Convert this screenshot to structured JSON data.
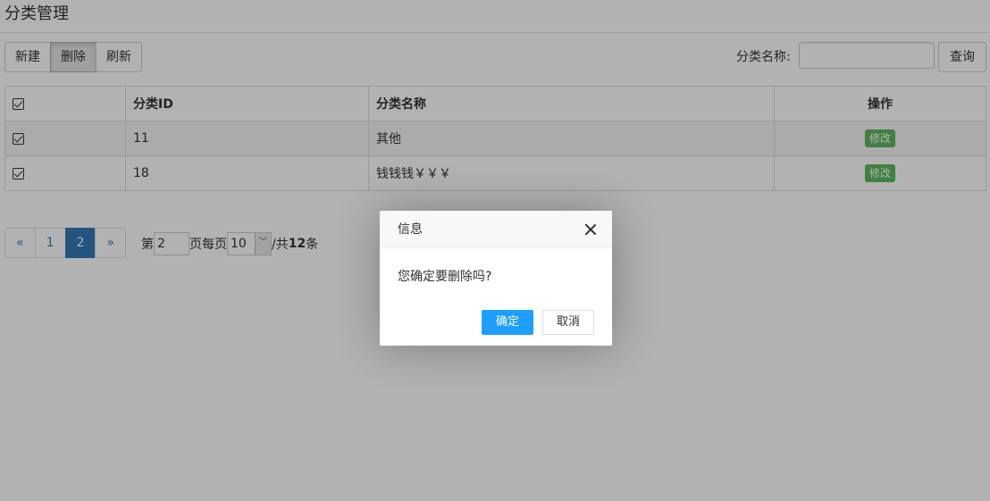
{
  "page": {
    "title": "分类管理"
  },
  "toolbar": {
    "new_label": "新建",
    "delete_label": "删除",
    "refresh_label": "刷新",
    "search_label": "分类名称:",
    "search_value": "",
    "search_button_label": "查询"
  },
  "table": {
    "headers": {
      "check": "",
      "id": "分类ID",
      "name": "分类名称",
      "operation": "操作"
    },
    "rows": [
      {
        "checked": true,
        "id": "11",
        "name": "其他",
        "action_label": "修改"
      },
      {
        "checked": true,
        "id": "18",
        "name": "钱钱钱￥￥￥",
        "action_label": "修改"
      }
    ]
  },
  "pagination": {
    "prev_label": "«",
    "pages": [
      "1",
      "2"
    ],
    "current_page": "2",
    "next_label": "»",
    "goto_prefix": "第",
    "goto_value": "2",
    "goto_suffix": "页",
    "page_size_prefix": "每页",
    "page_size_value": "10",
    "total_prefix": "/共",
    "total_count": "12",
    "total_suffix": "条"
  },
  "dialog": {
    "title": "信息",
    "message": "您确定要删除吗?",
    "confirm_label": "确定",
    "cancel_label": "取消"
  },
  "colors": {
    "primary_blue": "#337ab7",
    "dialog_confirm": "#1e9fff",
    "edit_green": "#5cb85c",
    "overlay": "rgba(0,0,0,0.3)"
  }
}
